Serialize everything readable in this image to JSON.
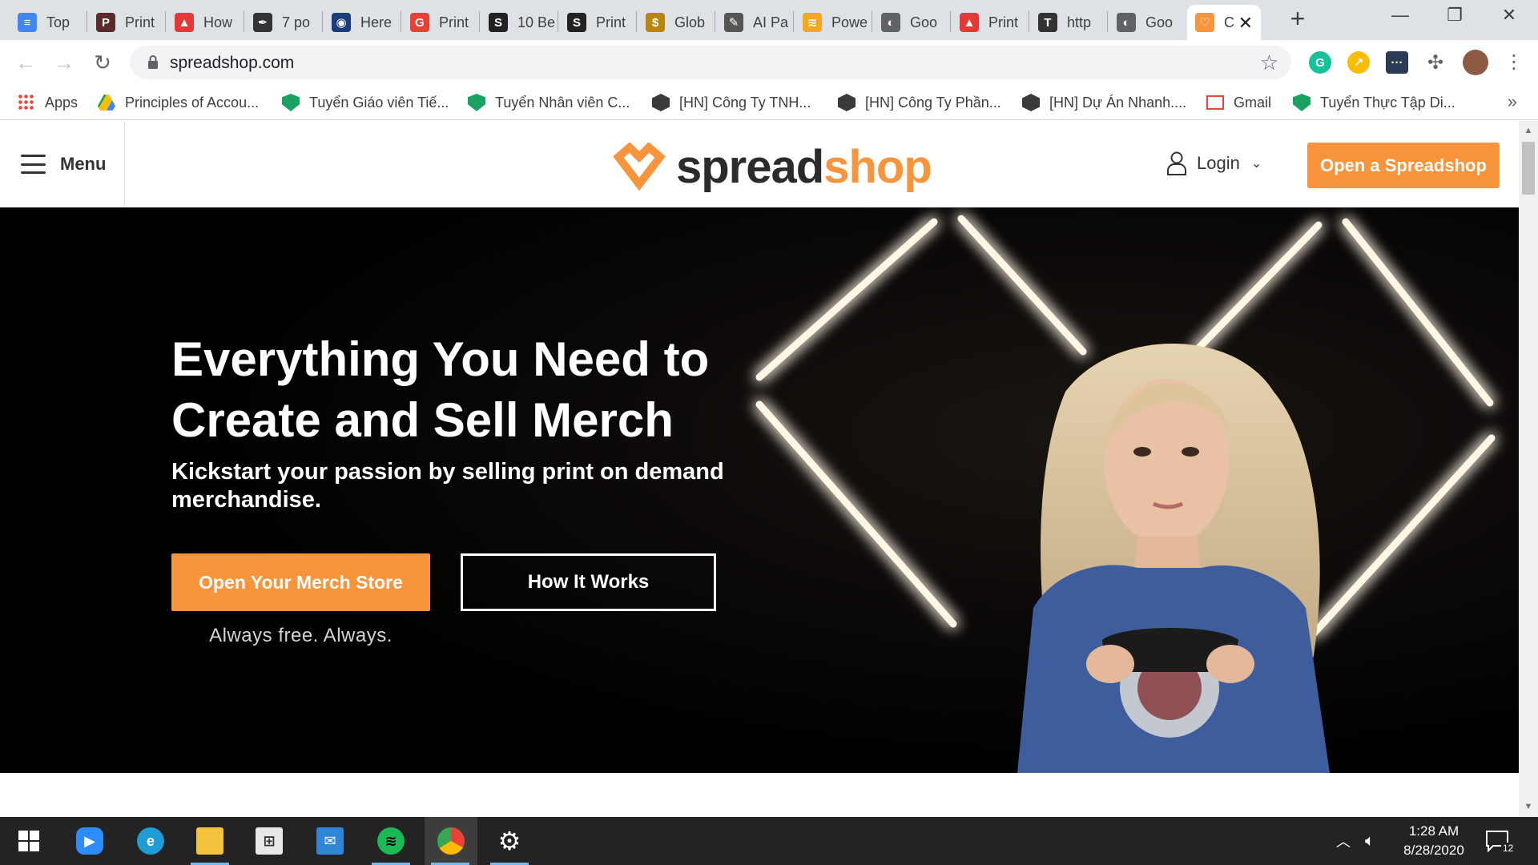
{
  "browser": {
    "tabs": [
      {
        "label": "Top",
        "icon": "google-docs-icon",
        "color": "#4285f4",
        "glyph": "≡"
      },
      {
        "label": "Print",
        "icon": "print-site-icon",
        "color": "#5b2a2a",
        "glyph": "P"
      },
      {
        "label": "How",
        "icon": "mountain-icon",
        "color": "#e53935",
        "glyph": "▲"
      },
      {
        "label": "7 po",
        "icon": "feather-icon",
        "color": "#333333",
        "glyph": "✒"
      },
      {
        "label": "Here",
        "icon": "owl-icon",
        "color": "#1a3d7c",
        "glyph": "◉"
      },
      {
        "label": "Print",
        "icon": "g-logo-icon",
        "color": "#e94235",
        "glyph": "G"
      },
      {
        "label": "10 Be",
        "icon": "s-logo-icon",
        "color": "#222222",
        "glyph": "S"
      },
      {
        "label": "Print",
        "icon": "s-logo-icon",
        "color": "#222222",
        "glyph": "S"
      },
      {
        "label": "Glob",
        "icon": "gold-coin-icon",
        "color": "#b8860b",
        "glyph": "$"
      },
      {
        "label": "AI Pa",
        "icon": "pen-icon",
        "color": "#555555",
        "glyph": "✎"
      },
      {
        "label": "Powe",
        "icon": "printful-icon",
        "color": "#f5a623",
        "glyph": "≋"
      },
      {
        "label": "Goo",
        "icon": "globe-icon",
        "color": "#5f6368",
        "glyph": "◐"
      },
      {
        "label": "Print",
        "icon": "mountain-icon",
        "color": "#e53935",
        "glyph": "▲"
      },
      {
        "label": "http",
        "icon": "tshirt-icon",
        "color": "#333333",
        "glyph": "T"
      },
      {
        "label": "Goo",
        "icon": "globe-icon",
        "color": "#5f6368",
        "glyph": "◐"
      },
      {
        "label": "C",
        "icon": "spreadshop-tab-icon",
        "color": "#f7943c",
        "glyph": "♡"
      }
    ],
    "url": "spreadshop.com",
    "bookmarks": [
      {
        "label": "Apps",
        "icon": "apps-grid-icon",
        "color": "#ea4335"
      },
      {
        "label": "Principles of Accou...",
        "icon": "google-drive-icon",
        "color": "#fbbc04"
      },
      {
        "label": "Tuyển Giáo viên Tiế...",
        "icon": "green-shield-icon",
        "color": "#1aa260"
      },
      {
        "label": "Tuyển Nhân viên C...",
        "icon": "green-shield-icon",
        "color": "#1aa260"
      },
      {
        "label": "[HN] Công Ty TNH...",
        "icon": "cube-icon",
        "color": "#3a3a3a"
      },
      {
        "label": "[HN] Công Ty Phần...",
        "icon": "cube-icon",
        "color": "#3a3a3a"
      },
      {
        "label": "[HN] Dự Án Nhanh....",
        "icon": "cube-icon",
        "color": "#3a3a3a"
      },
      {
        "label": "Gmail",
        "icon": "gmail-icon",
        "color": "#ea4335"
      },
      {
        "label": "Tuyển Thực Tập Di...",
        "icon": "green-shield-icon",
        "color": "#1aa260"
      }
    ]
  },
  "site": {
    "menu_label": "Menu",
    "logo_part1": "spread",
    "logo_part2": "shop",
    "login_label": "Login",
    "cta_label": "Open a Spreadshop",
    "accent_color": "#f7943c"
  },
  "hero": {
    "title": "Everything You Need to Create and Sell Merch",
    "subtitle": "Kickstart your passion by selling print on demand merchandise.",
    "primary_button": "Open Your Merch Store",
    "secondary_button": "How It Works",
    "note": "Always free. Always."
  },
  "taskbar": {
    "time": "1:28 AM",
    "date": "8/28/2020",
    "notifications": "12"
  }
}
